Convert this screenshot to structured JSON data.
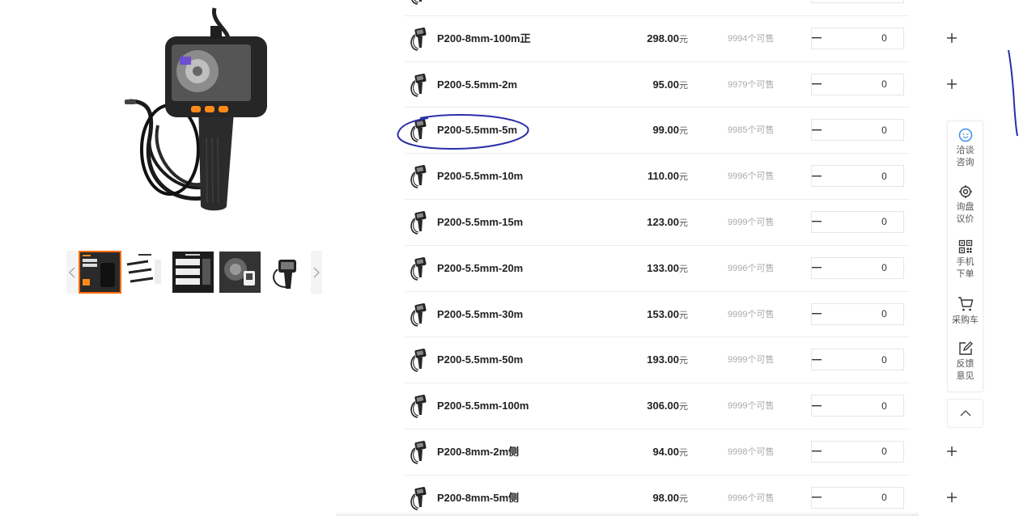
{
  "gallery": {
    "main_image_icon": "endoscope-camera-product-photo",
    "thumbnails": [
      {
        "icon": "product-thumbnail-1",
        "active": true
      },
      {
        "icon": "product-thumbnail-2",
        "active": false
      },
      {
        "icon": "product-thumbnail-3",
        "active": false
      },
      {
        "icon": "product-thumbnail-4",
        "active": false
      },
      {
        "icon": "product-thumbnail-5",
        "active": false
      }
    ]
  },
  "sku_list": {
    "unit": "元",
    "stock_suffix": "个可售",
    "items": [
      {
        "name": "",
        "price": "",
        "stock": "",
        "qty": ""
      },
      {
        "name": "P200-8mm-100m正",
        "price": "298.00",
        "stock": "9994",
        "qty": "0"
      },
      {
        "name": "P200-5.5mm-2m",
        "price": "95.00",
        "stock": "9979",
        "qty": "0"
      },
      {
        "name": "P200-5.5mm-5m",
        "price": "99.00",
        "stock": "9985",
        "qty": "0"
      },
      {
        "name": "P200-5.5mm-10m",
        "price": "110.00",
        "stock": "9996",
        "qty": "0"
      },
      {
        "name": "P200-5.5mm-15m",
        "price": "123.00",
        "stock": "9999",
        "qty": "0"
      },
      {
        "name": "P200-5.5mm-20m",
        "price": "133.00",
        "stock": "9996",
        "qty": "0"
      },
      {
        "name": "P200-5.5mm-30m",
        "price": "153.00",
        "stock": "9999",
        "qty": "0"
      },
      {
        "name": "P200-5.5mm-50m",
        "price": "193.00",
        "stock": "9999",
        "qty": "0"
      },
      {
        "name": "P200-5.5mm-100m",
        "price": "306.00",
        "stock": "9999",
        "qty": "0"
      },
      {
        "name": "P200-8mm-2m侧",
        "price": "94.00",
        "stock": "9998",
        "qty": "0"
      },
      {
        "name": "P200-8mm-5m侧",
        "price": "98.00",
        "stock": "9996",
        "qty": "0"
      }
    ]
  },
  "float_bar": {
    "items": [
      {
        "label": "洽谈咨询",
        "icon": "chat-icon"
      },
      {
        "label": "询盘议价",
        "icon": "target-icon"
      },
      {
        "label": "手机下单",
        "icon": "qrcode-icon"
      },
      {
        "label": "采购车",
        "icon": "cart-icon"
      },
      {
        "label": "反馈意见",
        "icon": "feedback-edit-icon"
      }
    ],
    "back_to_top_icon": "chevron-up-icon"
  },
  "colors": {
    "accent": "#ff6a00",
    "annotation_ink": "#2b2fa6",
    "float_chat": "#3d8ee8"
  }
}
